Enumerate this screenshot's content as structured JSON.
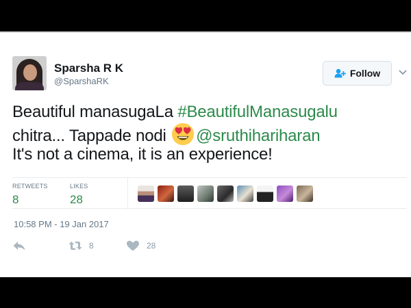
{
  "tweet": {
    "author_name": "Sparsha R K",
    "author_handle": "@SparshaRK",
    "follow_label": "Follow",
    "text": {
      "line1_plain": "Beautiful manasugaLa ",
      "line1_hashtag": "#BeautifulManasugalu",
      "line2_plain": "chitra... Tappade nodi ",
      "line2_mention": "@sruthihariharan",
      "line3_plain": "It's not a cinema, it is an experience!"
    },
    "emoji": "heart-eyes-emoji",
    "stats": {
      "retweets_label": "RETWEETS",
      "retweets_value": "8",
      "likes_label": "LIKES",
      "likes_value": "28"
    },
    "timestamp": "10:58 PM - 19 Jan 2017",
    "actions": {
      "retweet_count": "8",
      "like_count": "28"
    }
  },
  "colors": {
    "accent": "#2c8a4b",
    "follow_icon": "#1da1f2",
    "muted": "#657786"
  }
}
